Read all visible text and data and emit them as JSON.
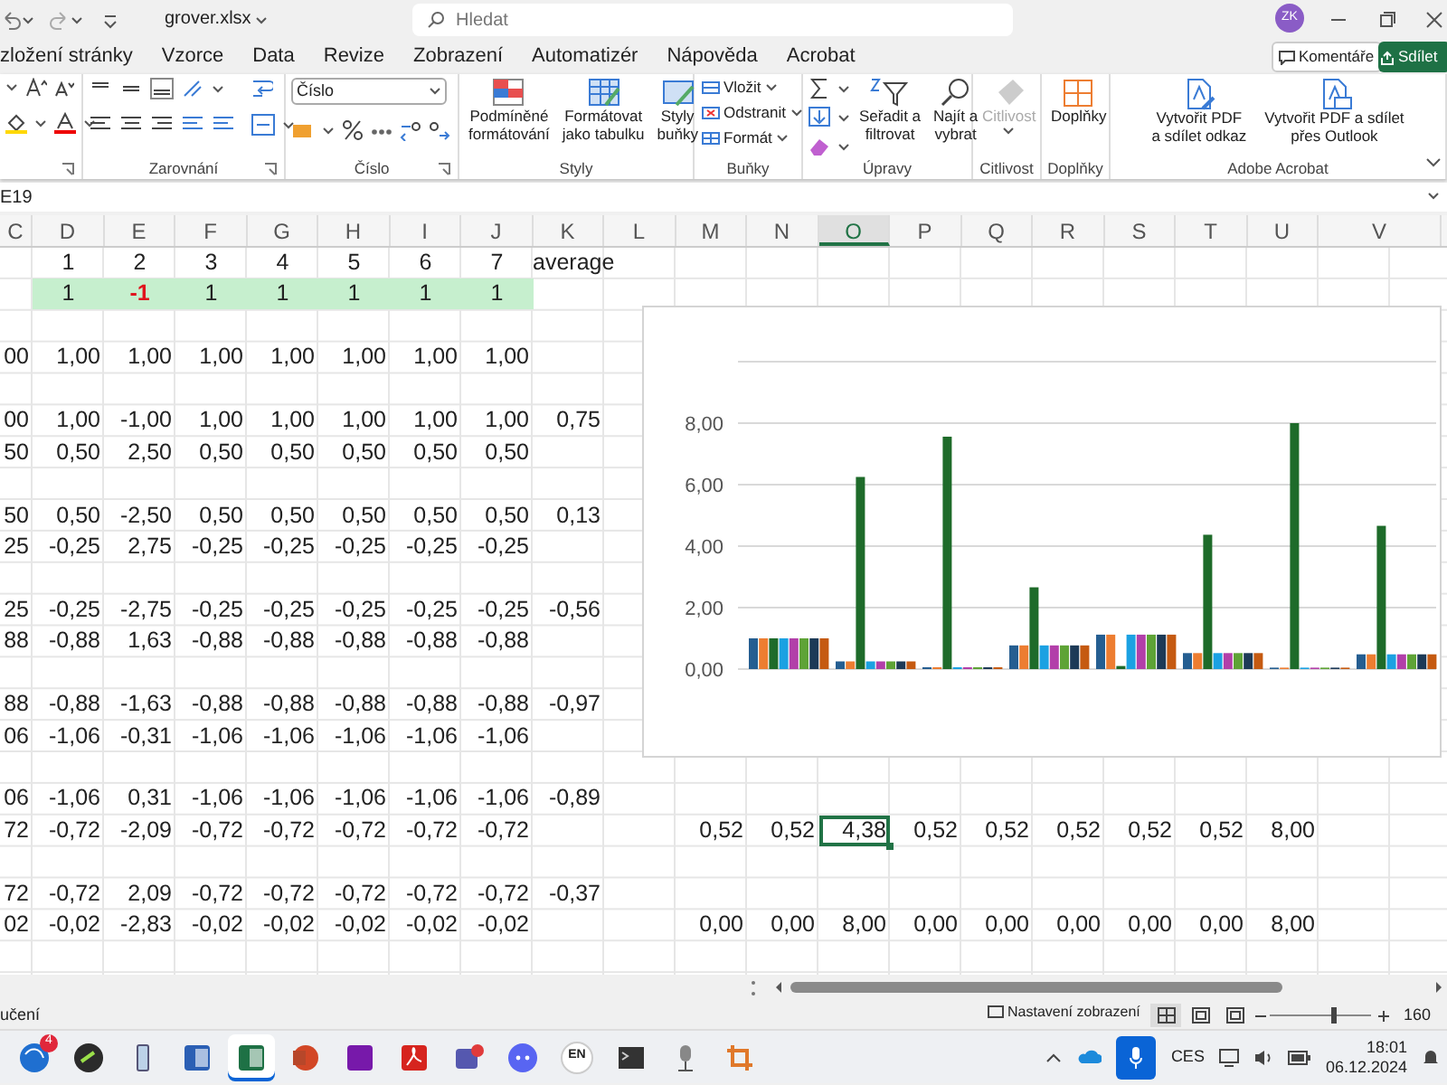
{
  "title_bar": {
    "file_name": "grover.xlsx",
    "search": {
      "placeholder": "Hledat"
    },
    "avatar": "ZK"
  },
  "ribbon_tabs": [
    {
      "label": "zložení stránky",
      "selected": false
    },
    {
      "label": "Vzorce",
      "selected": false
    },
    {
      "label": "Data",
      "selected": false
    },
    {
      "label": "Revize",
      "selected": false
    },
    {
      "label": "Zobrazení",
      "selected": false
    },
    {
      "label": "Automatizér",
      "selected": false
    },
    {
      "label": "Nápověda",
      "selected": false
    },
    {
      "label": "Acrobat",
      "selected": false
    }
  ],
  "comments_button": "Komentáře",
  "share_button": "Sdílet",
  "ribbon_groups": [
    {
      "kind": "font"
    },
    {
      "kind": "alignment",
      "label": "Zarovnání"
    },
    {
      "kind": "number",
      "label": "Číslo",
      "format_value": "Číslo"
    },
    {
      "kind": "styles",
      "label": "Styly",
      "buttons": [
        {
          "lines": [
            "Podmíněné",
            "formátování"
          ]
        },
        {
          "lines": [
            "Formátovat",
            "jako tabulku"
          ]
        },
        {
          "lines": [
            "Styly",
            "buňky"
          ]
        }
      ]
    },
    {
      "kind": "cells",
      "label": "Buňky",
      "items": [
        "Vložit",
        "Odstranit",
        "Formát"
      ]
    },
    {
      "kind": "editing",
      "label": "Úpravy",
      "buttons": [
        {
          "lines": [
            "Seřadit a",
            "filtrovat"
          ]
        },
        {
          "lines": [
            "Najít a",
            "vybrat"
          ]
        }
      ]
    },
    {
      "kind": "sensitivity",
      "label": "Citlivost",
      "button": "Citlivost",
      "disabled": true
    },
    {
      "kind": "addins",
      "label": "Doplňky",
      "button": "Doplňky"
    },
    {
      "kind": "acrobat",
      "label": "Adobe Acrobat",
      "buttons": [
        {
          "lines": [
            "Vytvořit PDF",
            "a sdílet odkaz"
          ]
        },
        {
          "lines": [
            "Vytvořit PDF a sdílet",
            "přes Outlook"
          ]
        }
      ]
    }
  ],
  "name_box": "E19",
  "columns": [
    {
      "label": "C",
      "selected": false
    },
    {
      "label": "D",
      "selected": false
    },
    {
      "label": "E",
      "selected": false
    },
    {
      "label": "F",
      "selected": false
    },
    {
      "label": "G",
      "selected": false
    },
    {
      "label": "H",
      "selected": false
    },
    {
      "label": "I",
      "selected": false
    },
    {
      "label": "J",
      "selected": false
    },
    {
      "label": "K",
      "selected": false
    },
    {
      "label": "L",
      "selected": false
    },
    {
      "label": "M",
      "selected": false
    },
    {
      "label": "N",
      "selected": false
    },
    {
      "label": "O",
      "selected": true
    },
    {
      "label": "P",
      "selected": false
    },
    {
      "label": "Q",
      "selected": false
    },
    {
      "label": "R",
      "selected": false
    },
    {
      "label": "S",
      "selected": false
    },
    {
      "label": "T",
      "selected": false
    },
    {
      "label": "U",
      "selected": false
    },
    {
      "label": "V",
      "selected": false
    }
  ],
  "rows": [
    {
      "kind": "index",
      "selected": false,
      "cells": {
        "D": "1",
        "E": "2",
        "F": "3",
        "G": "4",
        "H": "5",
        "I": "6",
        "J": "7",
        "K": "average"
      }
    },
    {
      "kind": "sign",
      "selected": false,
      "cells": {
        "D": {
          "text": "1",
          "flagged": false
        },
        "E": {
          "text": "-1",
          "flagged": true
        },
        "F": {
          "text": "1",
          "flagged": false
        },
        "G": {
          "text": "1",
          "flagged": false
        },
        "H": {
          "text": "1",
          "flagged": false
        },
        "I": {
          "text": "1",
          "flagged": false
        },
        "J": {
          "text": "1",
          "flagged": false
        }
      }
    },
    {
      "kind": "value",
      "selected": false,
      "cells": {}
    },
    {
      "kind": "value",
      "selected": false,
      "cells": {
        "C": "00",
        "D": "1,00",
        "E": "1,00",
        "F": "1,00",
        "G": "1,00",
        "H": "1,00",
        "I": "1,00",
        "J": "1,00"
      }
    },
    {
      "kind": "value",
      "selected": false,
      "cells": {}
    },
    {
      "kind": "value",
      "selected": false,
      "cells": {
        "C": "00",
        "D": "1,00",
        "E": "-1,00",
        "F": "1,00",
        "G": "1,00",
        "H": "1,00",
        "I": "1,00",
        "J": "1,00",
        "K": "0,75"
      }
    },
    {
      "kind": "value",
      "selected": false,
      "cells": {
        "C": "50",
        "D": "0,50",
        "E": "2,50",
        "F": "0,50",
        "G": "0,50",
        "H": "0,50",
        "I": "0,50",
        "J": "0,50"
      }
    },
    {
      "kind": "value",
      "selected": false,
      "cells": {}
    },
    {
      "kind": "value",
      "selected": false,
      "cells": {
        "C": "50",
        "D": "0,50",
        "E": "-2,50",
        "F": "0,50",
        "G": "0,50",
        "H": "0,50",
        "I": "0,50",
        "J": "0,50",
        "K": "0,13"
      }
    },
    {
      "kind": "value",
      "selected": false,
      "cells": {
        "C": "25",
        "D": "-0,25",
        "E": "2,75",
        "F": "-0,25",
        "G": "-0,25",
        "H": "-0,25",
        "I": "-0,25",
        "J": "-0,25"
      }
    },
    {
      "kind": "value",
      "selected": false,
      "cells": {}
    },
    {
      "kind": "value",
      "selected": false,
      "cells": {
        "C": "25",
        "D": "-0,25",
        "E": "-2,75",
        "F": "-0,25",
        "G": "-0,25",
        "H": "-0,25",
        "I": "-0,25",
        "J": "-0,25",
        "K": "-0,56"
      }
    },
    {
      "kind": "value",
      "selected": false,
      "cells": {
        "C": "88",
        "D": "-0,88",
        "E": "1,63",
        "F": "-0,88",
        "G": "-0,88",
        "H": "-0,88",
        "I": "-0,88",
        "J": "-0,88"
      }
    },
    {
      "kind": "value",
      "selected": false,
      "cells": {}
    },
    {
      "kind": "value",
      "selected": false,
      "cells": {
        "C": "88",
        "D": "-0,88",
        "E": "-1,63",
        "F": "-0,88",
        "G": "-0,88",
        "H": "-0,88",
        "I": "-0,88",
        "J": "-0,88",
        "K": "-0,97"
      }
    },
    {
      "kind": "value",
      "selected": false,
      "cells": {
        "C": "06",
        "D": "-1,06",
        "E": "-0,31",
        "F": "-1,06",
        "G": "-1,06",
        "H": "-1,06",
        "I": "-1,06",
        "J": "-1,06"
      }
    },
    {
      "kind": "value",
      "selected": false,
      "cells": {}
    },
    {
      "kind": "value",
      "selected": false,
      "cells": {
        "C": "06",
        "D": "-1,06",
        "E": "0,31",
        "F": "-1,06",
        "G": "-1,06",
        "H": "-1,06",
        "I": "-1,06",
        "J": "-1,06",
        "K": "-0,89"
      }
    },
    {
      "kind": "value",
      "selected": true,
      "cells": {
        "C": "72",
        "D": "-0,72",
        "E": "-2,09",
        "F": "-0,72",
        "G": "-0,72",
        "H": "-0,72",
        "I": "-0,72",
        "J": "-0,72",
        "M": "0,52",
        "N": "0,52",
        "O": "4,38",
        "P": "0,52",
        "Q": "0,52",
        "R": "0,52",
        "S": "0,52",
        "T": "0,52",
        "U": "8,00"
      }
    },
    {
      "kind": "value",
      "selected": false,
      "cells": {}
    },
    {
      "kind": "value",
      "selected": false,
      "cells": {
        "C": "72",
        "D": "-0,72",
        "E": "2,09",
        "F": "-0,72",
        "G": "-0,72",
        "H": "-0,72",
        "I": "-0,72",
        "J": "-0,72",
        "K": "-0,37"
      }
    },
    {
      "kind": "value",
      "selected": false,
      "cells": {
        "C": "02",
        "D": "-0,02",
        "E": "-2,83",
        "F": "-0,02",
        "G": "-0,02",
        "H": "-0,02",
        "I": "-0,02",
        "J": "-0,02",
        "M": "0,00",
        "N": "0,00",
        "O": "8,00",
        "P": "0,00",
        "Q": "0,00",
        "R": "0,00",
        "S": "0,00",
        "T": "0,00",
        "U": "8,00"
      }
    },
    {
      "kind": "value",
      "selected": false,
      "cells": {}
    }
  ],
  "chart": {
    "chart_data": {
      "type": "bar",
      "grid": true,
      "ylim": [
        0,
        10
      ],
      "yticks": [
        {
          "value": 0,
          "label": "0,00"
        },
        {
          "value": 2,
          "label": "2,00"
        },
        {
          "value": 4,
          "label": "4,00"
        },
        {
          "value": 6,
          "label": "6,00"
        },
        {
          "value": 8,
          "label": "8,00"
        }
      ],
      "series": [
        {
          "color": "#255e91",
          "values": [
            1,
            0.25,
            0.06,
            0.77,
            1.12,
            0.52,
            0,
            0.48
          ]
        },
        {
          "color": "#ed7d31",
          "values": [
            1,
            0.25,
            0.06,
            0.77,
            1.12,
            0.52,
            0,
            0.48
          ]
        },
        {
          "color": "#1e6b2a",
          "values": [
            1,
            6.25,
            7.56,
            2.66,
            0.1,
            4.37,
            8,
            4.66
          ]
        },
        {
          "color": "#1ba1e2",
          "values": [
            1,
            0.25,
            0.06,
            0.77,
            1.12,
            0.52,
            0,
            0.48
          ]
        },
        {
          "color": "#b23fa9",
          "values": [
            1,
            0.25,
            0.06,
            0.77,
            1.12,
            0.52,
            0,
            0.48
          ]
        },
        {
          "color": "#5ea336",
          "values": [
            1,
            0.25,
            0.06,
            0.77,
            1.12,
            0.52,
            0,
            0.48
          ]
        },
        {
          "color": "#1d3a57",
          "values": [
            1,
            0.25,
            0.06,
            0.77,
            1.12,
            0.52,
            0,
            0.48
          ]
        },
        {
          "color": "#c55a11",
          "values": [
            1,
            0.25,
            0.06,
            0.77,
            1.12,
            0.52,
            0,
            0.48
          ]
        }
      ]
    }
  },
  "status_bar": {
    "status_text": "učení",
    "view_settings": "Nastavení zobrazení",
    "views": [
      {
        "selected": true
      },
      {
        "selected": false
      },
      {
        "selected": false
      }
    ],
    "zoom_slider": {
      "level": 0.6
    },
    "zoom": "160"
  },
  "taskbar": {
    "notification_count": "4",
    "apps": [
      {
        "selected": false
      },
      {
        "selected": false
      },
      {
        "selected": false
      },
      {
        "selected": false
      },
      {
        "selected": true
      },
      {
        "selected": false
      },
      {
        "selected": false
      },
      {
        "selected": false
      },
      {
        "selected": false
      },
      {
        "selected": false
      },
      {
        "selected": false
      },
      {
        "selected": false
      },
      {
        "selected": false
      },
      {
        "selected": false
      }
    ],
    "language": "EN",
    "input_method": "CES",
    "time": "18:01",
    "date": "06.12.2024"
  }
}
